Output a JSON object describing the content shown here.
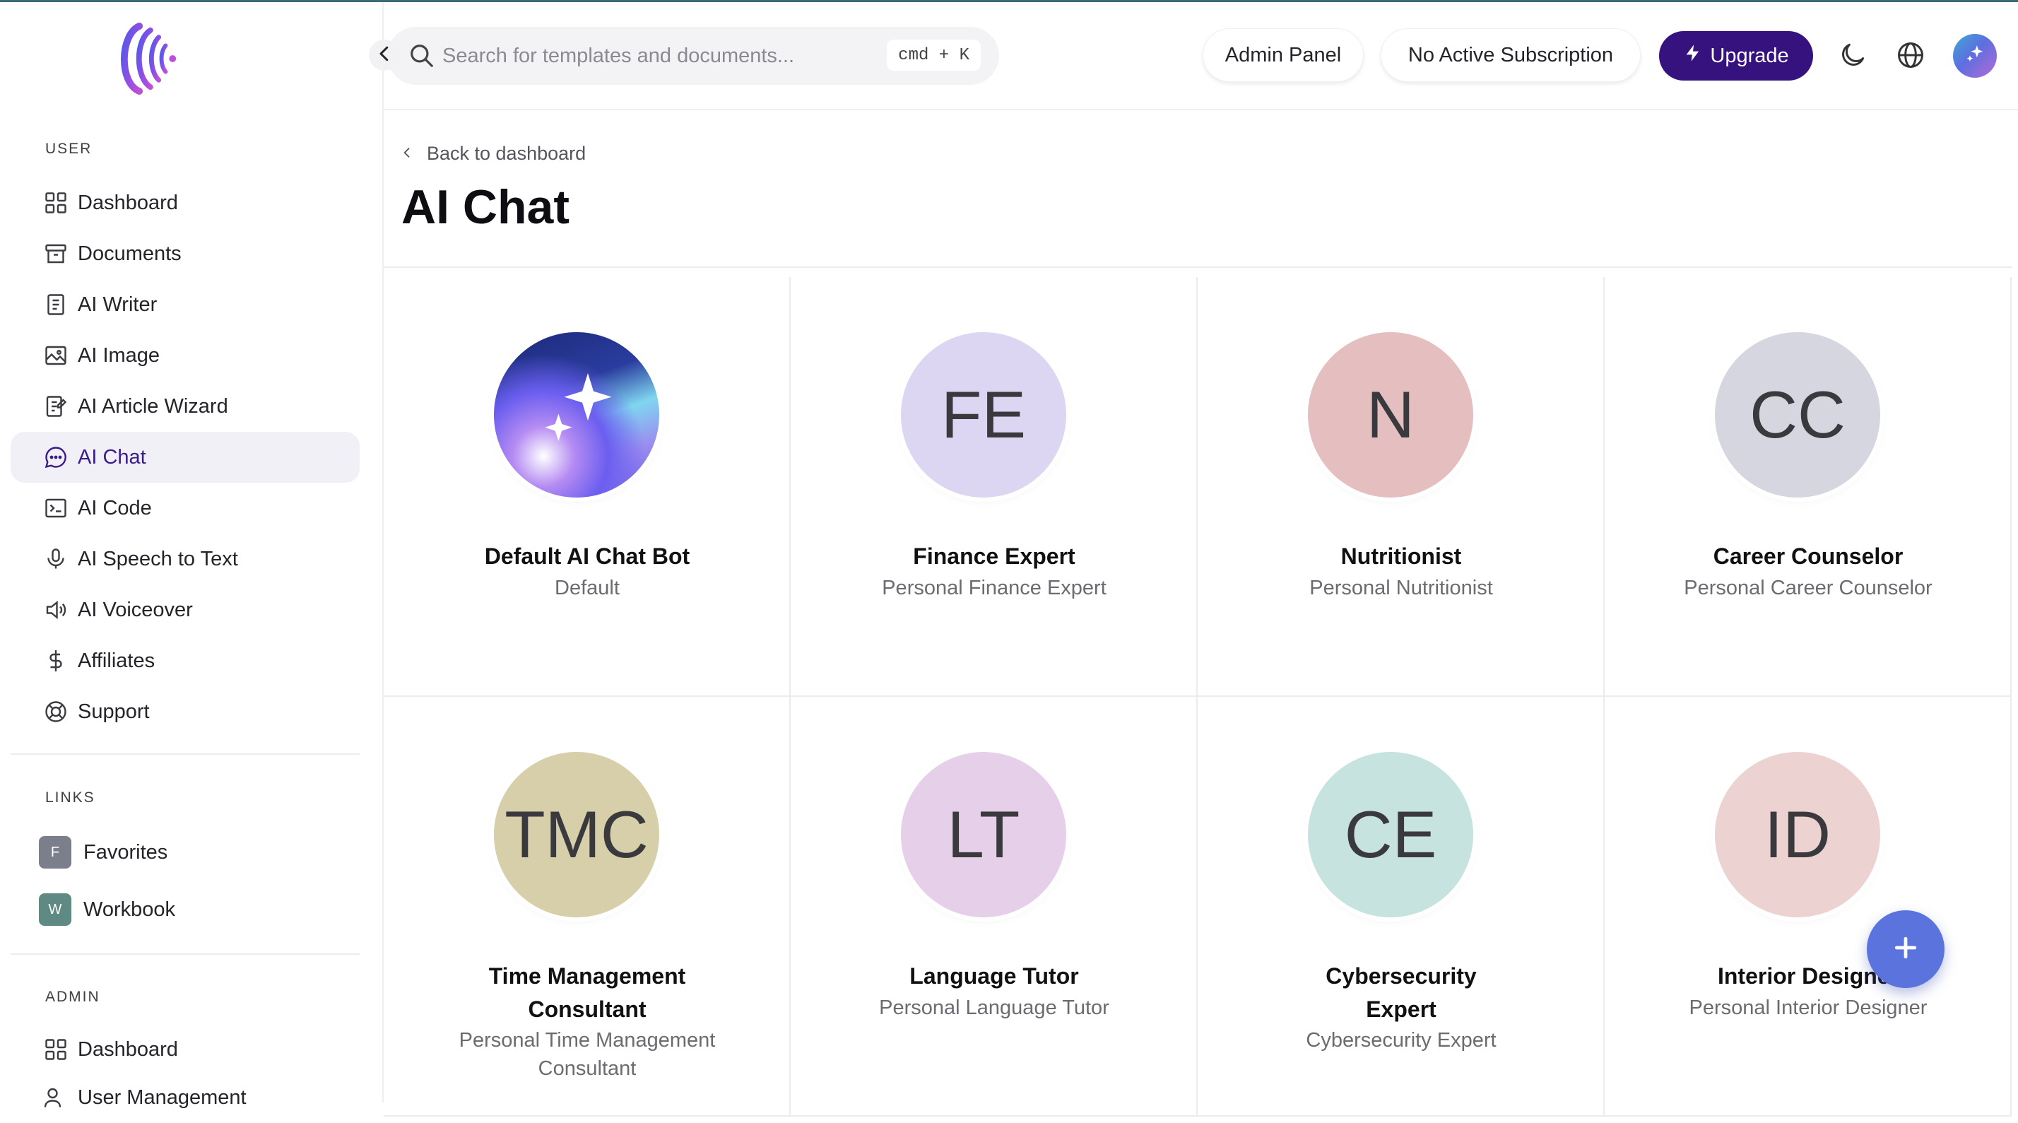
{
  "sidebar": {
    "user_section_label": "USER",
    "user_items": [
      {
        "label": "Dashboard",
        "icon": "grid-icon"
      },
      {
        "label": "Documents",
        "icon": "archive-icon"
      },
      {
        "label": "AI Writer",
        "icon": "document-icon"
      },
      {
        "label": "AI Image",
        "icon": "image-icon"
      },
      {
        "label": "AI Article Wizard",
        "icon": "article-icon"
      },
      {
        "label": "AI Chat",
        "icon": "chat-icon",
        "active": true
      },
      {
        "label": "AI Code",
        "icon": "terminal-icon"
      },
      {
        "label": "AI Speech to Text",
        "icon": "microphone-icon"
      },
      {
        "label": "AI Voiceover",
        "icon": "speaker-icon"
      },
      {
        "label": "Affiliates",
        "icon": "dollar-icon"
      },
      {
        "label": "Support",
        "icon": "lifebuoy-icon"
      }
    ],
    "links_section_label": "LINKS",
    "links": [
      {
        "badge": "F",
        "label": "Favorites",
        "color": "#7b7f8c"
      },
      {
        "badge": "W",
        "label": "Workbook",
        "color": "#5e8a83"
      }
    ],
    "admin_section_label": "ADMIN",
    "admin_items": [
      {
        "label": "Dashboard",
        "icon": "grid-icon"
      },
      {
        "label": "User Management",
        "icon": "users-icon"
      }
    ]
  },
  "header": {
    "search_placeholder": "Search for templates and documents...",
    "search_shortcut": "cmd + K",
    "admin_panel_label": "Admin Panel",
    "subscription_label": "No Active Subscription",
    "upgrade_label": "Upgrade"
  },
  "page": {
    "back_label": "Back to dashboard",
    "title": "AI Chat"
  },
  "chat_bots": [
    {
      "initials": "",
      "name": "Default AI Chat Bot",
      "desc": "Default",
      "color": "gradient"
    },
    {
      "initials": "FE",
      "name": "Finance Expert",
      "desc": "Personal Finance Expert",
      "color": "#dcd6f3"
    },
    {
      "initials": "N",
      "name": "Nutritionist",
      "desc": "Personal Nutritionist",
      "color": "#e5bfbf"
    },
    {
      "initials": "CC",
      "name": "Career Counselor",
      "desc": "Personal Career Counselor",
      "color": "#d6d6e0"
    },
    {
      "initials": "TMC",
      "name": "Time Management Consultant",
      "desc": "Personal Time Management Consultant",
      "color": "#d6cfa9"
    },
    {
      "initials": "LT",
      "name": "Language Tutor",
      "desc": "Personal Language Tutor",
      "color": "#e6cfe8"
    },
    {
      "initials": "CE",
      "name": "Cybersecurity Expert",
      "desc": "Cybersecurity Expert",
      "color": "#c6e3e0"
    },
    {
      "initials": "ID",
      "name": "Interior Designer",
      "desc": "Personal Interior Designer",
      "color": "#ecd3d2"
    }
  ],
  "colors": {
    "accent": "#35127d",
    "active_nav_bg": "#f2f0f7",
    "fab": "#5b73dc"
  }
}
